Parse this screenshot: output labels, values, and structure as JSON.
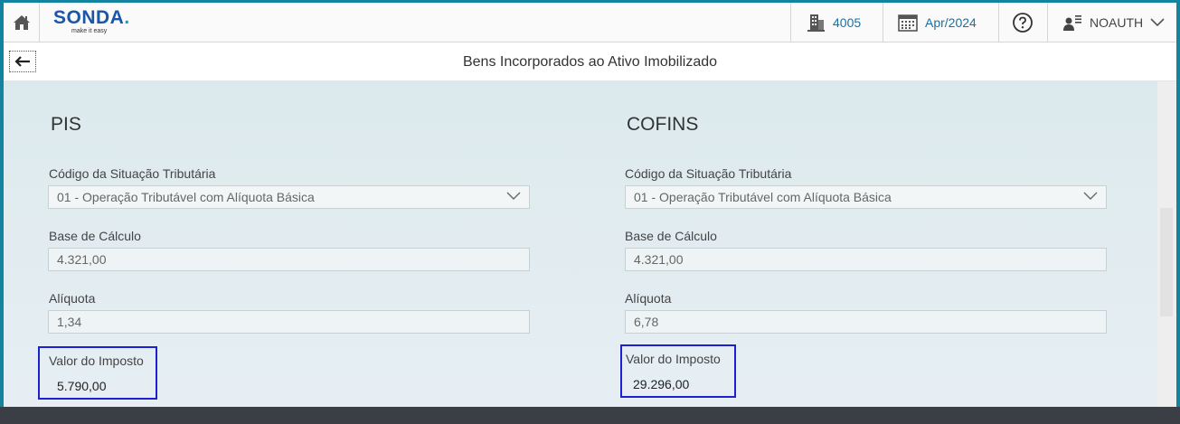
{
  "header": {
    "logo_text": "SONDA",
    "logo_dot": ".",
    "logo_tagline": "make it easy",
    "company_code": "4005",
    "period": "Apr/2024",
    "user": "NOAUTH"
  },
  "titlebar": {
    "title": "Bens Incorporados ao Ativo Imobilizado"
  },
  "pis": {
    "title": "PIS",
    "cst_label": "Código da Situação Tributária",
    "cst_value": "01 - Operação Tributável com Alíquota Básica",
    "base_label": "Base de Cálculo",
    "base_value": "4.321,00",
    "aliquota_label": "Alíquota",
    "aliquota_value": "1,34",
    "imposto_label": "Valor do Imposto",
    "imposto_value": "5.790,00"
  },
  "cofins": {
    "title": "COFINS",
    "cst_label": "Código da Situação Tributária",
    "cst_value": "01 - Operação Tributável com Alíquota Básica",
    "base_label": "Base de Cálculo",
    "base_value": "4.321,00",
    "aliquota_label": "Alíquota",
    "aliquota_value": "6,78",
    "imposto_label": "Valor do Imposto",
    "imposto_value": "29.296,00"
  },
  "colors": {
    "brand": "#1b57a8",
    "link": "#1c6ea4",
    "highlight_border": "#1c22d4"
  }
}
